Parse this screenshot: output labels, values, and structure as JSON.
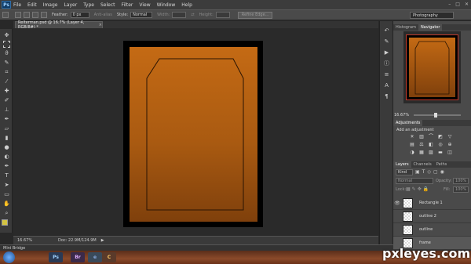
{
  "app": {
    "logo": "Ps",
    "watermark": "pxleyes.com"
  },
  "menu": [
    "File",
    "Edit",
    "Image",
    "Layer",
    "Type",
    "Select",
    "Filter",
    "View",
    "Window",
    "Help"
  ],
  "window_controls": [
    "–",
    "□",
    "✕"
  ],
  "options": {
    "feather_label": "Feather:",
    "feather_value": "0 px",
    "antialias_label": "Anti-alias",
    "style_label": "Style:",
    "style_value": "Normal",
    "width_label": "Width:",
    "height_label": "Height:",
    "refine_button": "Refine Edge...",
    "workspace": "Photography"
  },
  "document": {
    "tab": "Reiterman.psd @ 16.7% (Layer 4, RGB/8#) *",
    "close": "×"
  },
  "status": {
    "zoom": "16.67%",
    "doc": "Doc: 22.9M/124.9M"
  },
  "mini_bridge": "Mini Bridge",
  "panels": {
    "nav_tabs": [
      "Histogram",
      "Navigator"
    ],
    "nav_zoom": "16.67%",
    "adj_tab": "Adjustments",
    "adj_title": "Add an adjustment",
    "layer_tabs": [
      "Layers",
      "Channels",
      "Paths"
    ],
    "kind": "Kind",
    "blend": "Normal",
    "opacity_label": "Opacity:",
    "opacity_value": "100%",
    "lock_label": "Lock:",
    "fill_label": "Fill:",
    "fill_value": "100%",
    "layers": [
      {
        "name": "Rectangle 1"
      },
      {
        "name": "outline 2"
      },
      {
        "name": "outline"
      },
      {
        "name": "frame"
      }
    ]
  },
  "taskbar_apps": [
    "Ps",
    "Br",
    "e",
    "C"
  ]
}
